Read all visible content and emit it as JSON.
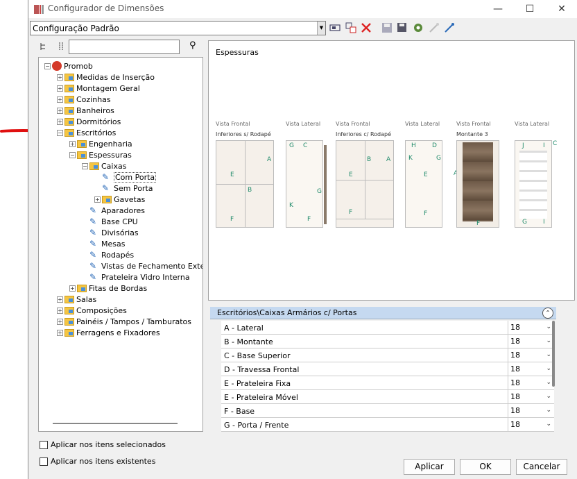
{
  "window": {
    "title": "Configurador de Dimensões",
    "min": "—",
    "max": "☐",
    "close": "✕"
  },
  "config": {
    "value": "Configuração Padrão"
  },
  "tree": [
    {
      "label": "Promob",
      "level": 0,
      "tog": "−",
      "icon": "promob"
    },
    {
      "label": "Medidas de Inserção",
      "level": 1,
      "tog": "+",
      "icon": "folder"
    },
    {
      "label": "Montagem Geral",
      "level": 1,
      "tog": "+",
      "icon": "folder"
    },
    {
      "label": "Cozinhas",
      "level": 1,
      "tog": "+",
      "icon": "folder"
    },
    {
      "label": "Banheiros",
      "level": 1,
      "tog": "+",
      "icon": "folder"
    },
    {
      "label": "Dormitórios",
      "level": 1,
      "tog": "+",
      "icon": "folder"
    },
    {
      "label": "Escritórios",
      "level": 1,
      "tog": "−",
      "icon": "folder"
    },
    {
      "label": "Engenharia",
      "level": 2,
      "tog": "+",
      "icon": "folder"
    },
    {
      "label": "Espessuras",
      "level": 2,
      "tog": "−",
      "icon": "folder"
    },
    {
      "label": "Caixas",
      "level": 3,
      "tog": "−",
      "icon": "folder"
    },
    {
      "label": "Com Porta",
      "level": 4,
      "tog": "",
      "icon": "pencil"
    },
    {
      "label": "Sem Porta",
      "level": 4,
      "tog": "",
      "icon": "pencil"
    },
    {
      "label": "Gavetas",
      "level": 4,
      "tog": "+",
      "icon": "folder"
    },
    {
      "label": "Aparadores",
      "level": 3,
      "tog": "",
      "icon": "pencil"
    },
    {
      "label": "Base CPU",
      "level": 3,
      "tog": "",
      "icon": "pencil"
    },
    {
      "label": "Divisórias",
      "level": 3,
      "tog": "",
      "icon": "pencil"
    },
    {
      "label": "Mesas",
      "level": 3,
      "tog": "",
      "icon": "pencil"
    },
    {
      "label": "Rodapés",
      "level": 3,
      "tog": "",
      "icon": "pencil"
    },
    {
      "label": "Vistas de Fechamento Exter",
      "level": 3,
      "tog": "",
      "icon": "pencil"
    },
    {
      "label": "Prateleira Vidro Interna",
      "level": 3,
      "tog": "",
      "icon": "pencil"
    },
    {
      "label": "Fitas de Bordas",
      "level": 2,
      "tog": "+",
      "icon": "folder"
    },
    {
      "label": "Salas",
      "level": 1,
      "tog": "+",
      "icon": "folder"
    },
    {
      "label": "Composições",
      "level": 1,
      "tog": "+",
      "icon": "folder"
    },
    {
      "label": "Painéis / Tampos / Tamburatos",
      "level": 1,
      "tog": "+",
      "icon": "folder"
    },
    {
      "label": "Ferragens e Fixadores",
      "level": 1,
      "tog": "+",
      "icon": "folder"
    }
  ],
  "preview": {
    "title": "Espessuras",
    "views": [
      "Vista Frontal",
      "Vista Lateral",
      "Vista Frontal",
      "Vista Lateral",
      "Vista Frontal",
      "Vista Lateral"
    ],
    "descs": [
      "Inferiores s/ Rodapé",
      "Inferiores c/ Rodapé",
      "Montante 3"
    ]
  },
  "props": {
    "title": "Escritórios\\Caixas Armários c/ Portas",
    "rows": [
      {
        "label": "A - Lateral",
        "value": "18"
      },
      {
        "label": "B - Montante",
        "value": "18"
      },
      {
        "label": "C - Base Superior",
        "value": "18"
      },
      {
        "label": "D - Travessa Frontal",
        "value": "18"
      },
      {
        "label": "E - Prateleira Fixa",
        "value": "18"
      },
      {
        "label": "E - Prateleira Móvel",
        "value": "18"
      },
      {
        "label": "F - Base",
        "value": "18"
      },
      {
        "label": "G - Porta / Frente",
        "value": "18"
      }
    ]
  },
  "checks": {
    "selected": "Aplicar nos itens selecionados",
    "existing": "Aplicar nos itens existentes"
  },
  "buttons": {
    "apply": "Aplicar",
    "ok": "OK",
    "cancel": "Cancelar"
  }
}
